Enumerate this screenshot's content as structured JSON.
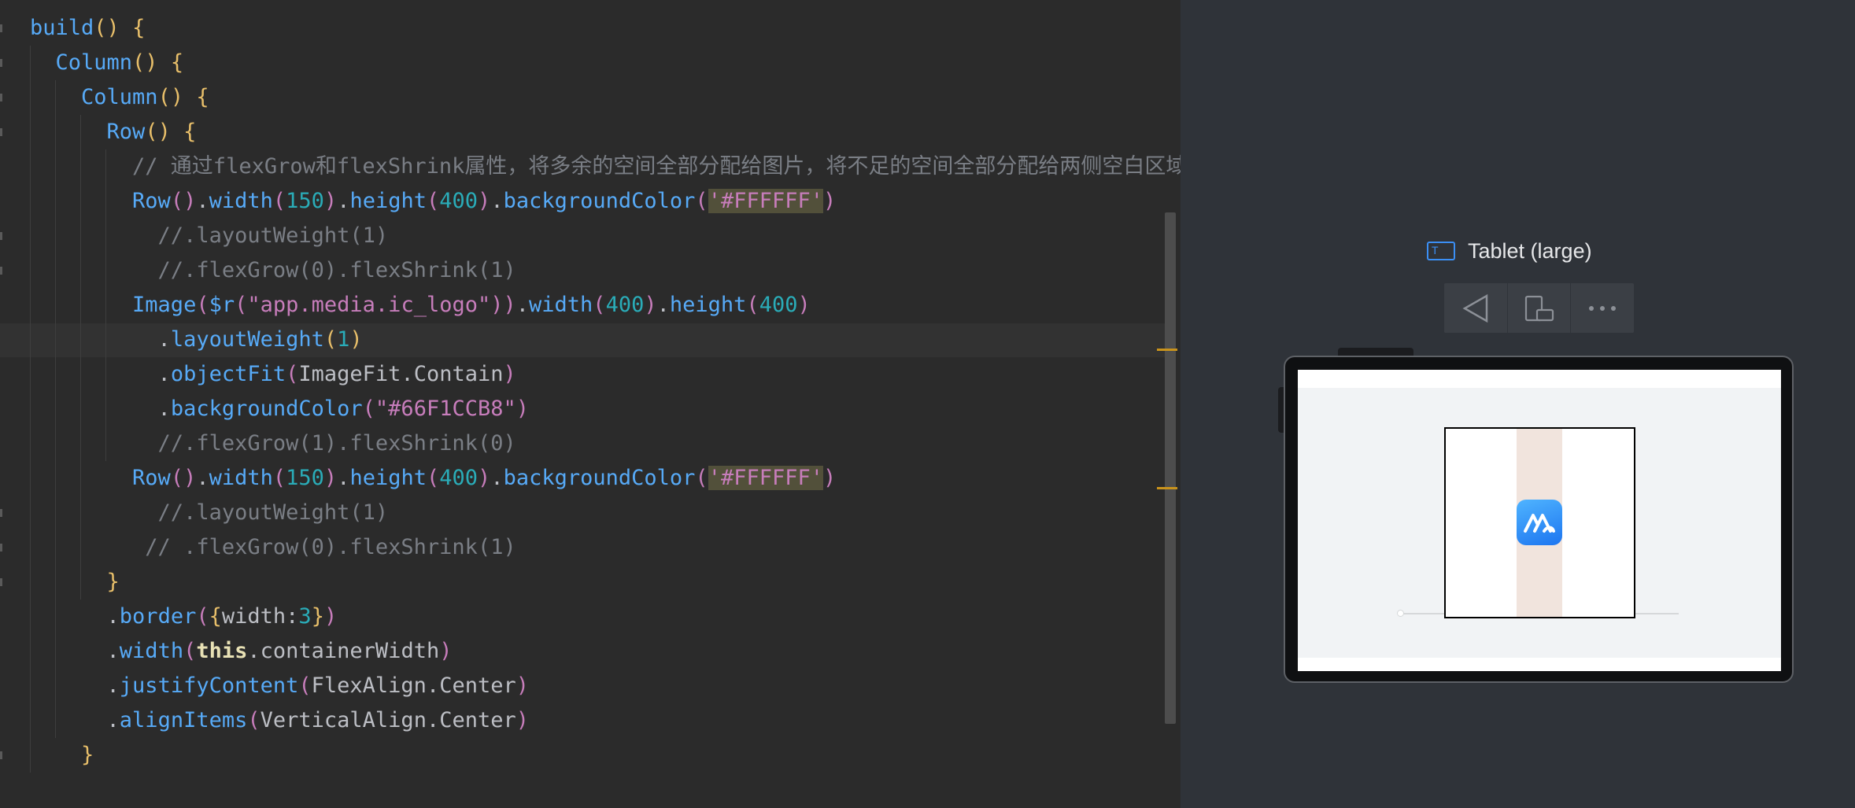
{
  "editor": {
    "lines": [
      [
        {
          "t": "build",
          "c": "fn"
        },
        {
          "t": "() ",
          "c": "pb"
        },
        {
          "t": "{",
          "c": "pb"
        }
      ],
      [
        {
          "t": "  Column",
          "c": "fn"
        },
        {
          "t": "() ",
          "c": "pb"
        },
        {
          "t": "{",
          "c": "pb"
        }
      ],
      [
        {
          "t": "    Column",
          "c": "fn"
        },
        {
          "t": "() ",
          "c": "pb"
        },
        {
          "t": "{",
          "c": "pb"
        }
      ],
      [
        {
          "t": "      Row",
          "c": "fn"
        },
        {
          "t": "() ",
          "c": "pb"
        },
        {
          "t": "{",
          "c": "pb"
        }
      ],
      [
        {
          "t": "        // 通过flexGrow和flexShrink属性，将多余的空间全部分配给图片，将不足的空间全部分配给两侧空白区域。",
          "c": "cm"
        }
      ],
      [
        {
          "t": "        Row",
          "c": "fn"
        },
        {
          "t": "()",
          "c": "pp"
        },
        {
          "t": ".",
          "c": "wt"
        },
        {
          "t": "width",
          "c": "fn"
        },
        {
          "t": "(",
          "c": "pp"
        },
        {
          "t": "150",
          "c": "num"
        },
        {
          "t": ")",
          "c": "pp"
        },
        {
          "t": ".",
          "c": "wt"
        },
        {
          "t": "height",
          "c": "fn"
        },
        {
          "t": "(",
          "c": "pp"
        },
        {
          "t": "400",
          "c": "num"
        },
        {
          "t": ")",
          "c": "pp"
        },
        {
          "t": ".",
          "c": "wt"
        },
        {
          "t": "backgroundColor",
          "c": "fn"
        },
        {
          "t": "(",
          "c": "pp"
        },
        {
          "t": "'#FFFFFF'",
          "c": "hlstr"
        },
        {
          "t": ")",
          "c": "pp"
        }
      ],
      [
        {
          "t": "          //.layoutWeight(1)",
          "c": "cm"
        }
      ],
      [
        {
          "t": "          //.flexGrow(0).flexShrink(1)",
          "c": "cm"
        }
      ],
      [
        {
          "t": "        Image",
          "c": "fn"
        },
        {
          "t": "(",
          "c": "pp"
        },
        {
          "t": "$r",
          "c": "fn"
        },
        {
          "t": "(",
          "c": "pp"
        },
        {
          "t": "\"app.media.ic_logo\"",
          "c": "pp"
        },
        {
          "t": "))",
          "c": "pp"
        },
        {
          "t": ".",
          "c": "wt"
        },
        {
          "t": "width",
          "c": "fn"
        },
        {
          "t": "(",
          "c": "pp"
        },
        {
          "t": "400",
          "c": "num"
        },
        {
          "t": ")",
          "c": "pp"
        },
        {
          "t": ".",
          "c": "wt"
        },
        {
          "t": "height",
          "c": "fn"
        },
        {
          "t": "(",
          "c": "pp"
        },
        {
          "t": "400",
          "c": "num"
        },
        {
          "t": ")",
          "c": "pp"
        }
      ],
      [
        {
          "t": "          .",
          "c": "wt"
        },
        {
          "t": "layoutWeight",
          "c": "fn"
        },
        {
          "t": "(",
          "c": "pb"
        },
        {
          "t": "1",
          "c": "num"
        },
        {
          "t": ")",
          "c": "pb"
        }
      ],
      [
        {
          "t": "          .",
          "c": "wt"
        },
        {
          "t": "objectFit",
          "c": "fn"
        },
        {
          "t": "(",
          "c": "pp"
        },
        {
          "t": "ImageFit.Contain",
          "c": "wt"
        },
        {
          "t": ")",
          "c": "pp"
        }
      ],
      [
        {
          "t": "          .",
          "c": "wt"
        },
        {
          "t": "backgroundColor",
          "c": "fn"
        },
        {
          "t": "(",
          "c": "pp"
        },
        {
          "t": "\"#66F1CCB8\"",
          "c": "pp"
        },
        {
          "t": ")",
          "c": "pp"
        }
      ],
      [
        {
          "t": "          //.flexGrow(1).flexShrink(0)",
          "c": "cm"
        }
      ],
      [
        {
          "t": "        Row",
          "c": "fn"
        },
        {
          "t": "()",
          "c": "pp"
        },
        {
          "t": ".",
          "c": "wt"
        },
        {
          "t": "width",
          "c": "fn"
        },
        {
          "t": "(",
          "c": "pp"
        },
        {
          "t": "150",
          "c": "num"
        },
        {
          "t": ")",
          "c": "pp"
        },
        {
          "t": ".",
          "c": "wt"
        },
        {
          "t": "height",
          "c": "fn"
        },
        {
          "t": "(",
          "c": "pp"
        },
        {
          "t": "400",
          "c": "num"
        },
        {
          "t": ")",
          "c": "pp"
        },
        {
          "t": ".",
          "c": "wt"
        },
        {
          "t": "backgroundColor",
          "c": "fn"
        },
        {
          "t": "(",
          "c": "pp"
        },
        {
          "t": "'#FFFFFF'",
          "c": "hlstr"
        },
        {
          "t": ")",
          "c": "pp"
        }
      ],
      [
        {
          "t": "          //.layoutWeight(1)",
          "c": "cm"
        }
      ],
      [
        {
          "t": "         // .flexGrow(0).flexShrink(1)",
          "c": "cm"
        }
      ],
      [
        {
          "t": "      }",
          "c": "pb"
        }
      ],
      [
        {
          "t": "      .",
          "c": "wt"
        },
        {
          "t": "border",
          "c": "fn"
        },
        {
          "t": "(",
          "c": "pp"
        },
        {
          "t": "{",
          "c": "pb"
        },
        {
          "t": "width",
          "c": "wt"
        },
        {
          "t": ":",
          "c": "wt"
        },
        {
          "t": "3",
          "c": "num"
        },
        {
          "t": "}",
          "c": "pb"
        },
        {
          "t": ")",
          "c": "pp"
        }
      ],
      [
        {
          "t": "      .",
          "c": "wt"
        },
        {
          "t": "width",
          "c": "fn"
        },
        {
          "t": "(",
          "c": "pp"
        },
        {
          "t": "this",
          "c": "bold"
        },
        {
          "t": ".containerWidth",
          "c": "wt"
        },
        {
          "t": ")",
          "c": "pp"
        }
      ],
      [
        {
          "t": "      .",
          "c": "wt"
        },
        {
          "t": "justifyContent",
          "c": "fn"
        },
        {
          "t": "(",
          "c": "pp"
        },
        {
          "t": "FlexAlign.Center",
          "c": "wt"
        },
        {
          "t": ")",
          "c": "pp"
        }
      ],
      [
        {
          "t": "      .",
          "c": "wt"
        },
        {
          "t": "alignItems",
          "c": "fn"
        },
        {
          "t": "(",
          "c": "pp"
        },
        {
          "t": "VerticalAlign.Center",
          "c": "wt"
        },
        {
          "t": ")",
          "c": "pp"
        }
      ],
      [
        {
          "t": "    }",
          "c": "pb"
        }
      ]
    ]
  },
  "preview": {
    "device_icon_letter": "T",
    "device_label": "Tablet (large)",
    "toolbar": [
      "back-icon",
      "rotate-device-icon",
      "more-icon"
    ]
  },
  "colors": {
    "image_background": "#66F1CCB8",
    "row_background": "#FFFFFF",
    "accent": "#3b8ff5",
    "marker": "#c9931c"
  }
}
